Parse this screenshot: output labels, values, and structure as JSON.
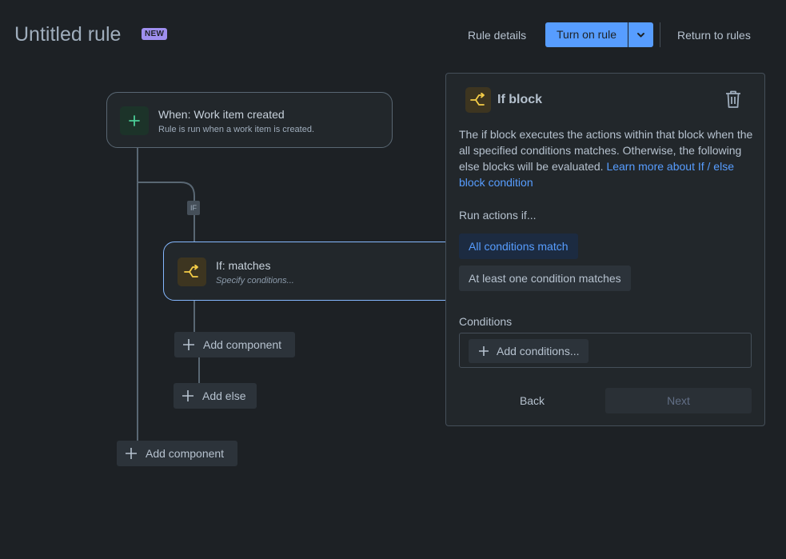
{
  "header": {
    "title": "Untitled rule",
    "badge": "NEW",
    "rule_details": "Rule details",
    "turn_on_rule": "Turn on rule",
    "return_to_rules": "Return to rules"
  },
  "flow": {
    "trigger": {
      "title": "When: Work item created",
      "subtitle": "Rule is run when a work item is created."
    },
    "if_tag": "IF",
    "if_block": {
      "title": "If: matches",
      "subtitle": "Specify conditions..."
    },
    "add_component_inner": "Add component",
    "add_else": "Add else",
    "add_component_outer": "Add component"
  },
  "panel": {
    "title": "If block",
    "description": "The if block executes the actions within that block when the all specified conditions matches. Otherwise, the following else blocks will be evaluated.",
    "learn_more": "Learn more about If / else block condition",
    "run_actions_label": "Run actions if...",
    "options": [
      "All conditions match",
      "At least one condition matches"
    ],
    "selected_option": "All conditions match",
    "conditions_label": "Conditions",
    "add_conditions": "Add conditions...",
    "back": "Back",
    "next": "Next"
  },
  "colors": {
    "background": "#1d2125",
    "card": "#22272b",
    "primary": "#579dff",
    "selected_border": "#85b8ff",
    "badge": "#9f8fef",
    "trigger_accent": "#4bce97",
    "branch_accent": "#f5cd47"
  },
  "icons": {
    "trigger": "plus-icon",
    "branch": "branch-icon",
    "delete": "trash-icon",
    "menu": "chevron-down-icon"
  }
}
